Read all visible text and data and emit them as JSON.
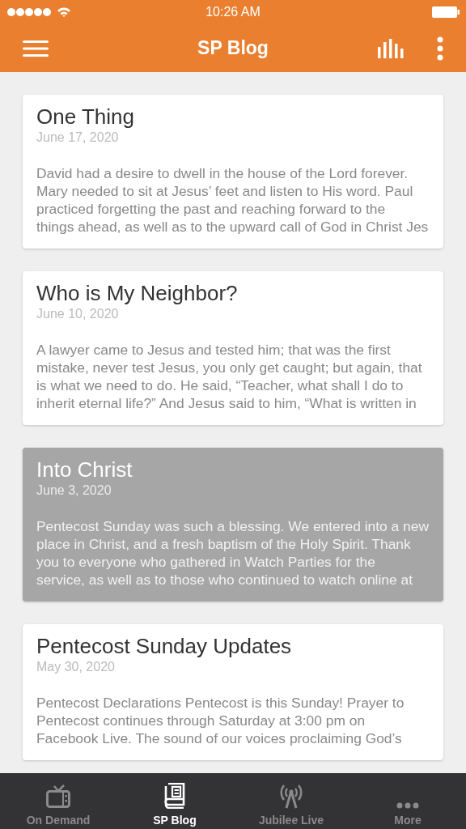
{
  "status_bar": {
    "time": "10:26 AM"
  },
  "header": {
    "title": "SP Blog"
  },
  "posts": [
    {
      "title": "One Thing",
      "date": "June 17, 2020",
      "excerpt": [
        "David had a desire to dwell in the house of the Lord forever.",
        "Mary needed to sit at Jesus’ feet and listen to His word. Paul",
        "practiced forgetting the past and reaching forward to the",
        "things ahead, as well as to the upward call of God in Christ Jes"
      ],
      "selected": false
    },
    {
      "title": "Who is My Neighbor?",
      "date": "June 10, 2020",
      "excerpt": [
        "A lawyer came to Jesus and tested him; that was the first",
        "mistake, never test Jesus, you only get caught; but again, that",
        "is what we need to do. He said, “Teacher, what shall I do to",
        "inherit eternal life?” And Jesus said to him, “What is written in"
      ],
      "selected": false
    },
    {
      "title": "Into Christ",
      "date": "June 3, 2020",
      "excerpt": [
        "Pentecost Sunday was such a blessing. We entered into a new",
        "place in Christ, and a fresh baptism of the Holy Spirit. Thank",
        "you to everyone who gathered in Watch Parties for the",
        "service, as well as to those who continued to watch online at"
      ],
      "selected": true
    },
    {
      "title": "Pentecost Sunday Updates",
      "date": "May 30, 2020",
      "excerpt": [
        "Pentecost Declarations Pentecost is this Sunday! Prayer to",
        "Pentecost continues through Saturday at 3:00 pm on",
        "Facebook Live. The sound of our voices proclaiming God’s"
      ],
      "selected": false
    }
  ],
  "tabs": [
    {
      "label": "On Demand",
      "kind": "tv",
      "selected": false
    },
    {
      "label": "SP Blog",
      "kind": "book",
      "selected": true
    },
    {
      "label": "Jubilee Live",
      "kind": "antenna",
      "selected": false
    },
    {
      "label": "More",
      "kind": "more",
      "selected": false
    }
  ]
}
